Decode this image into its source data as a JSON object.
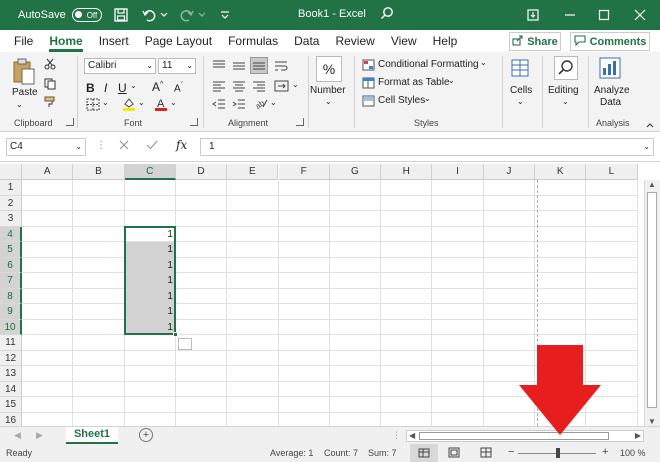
{
  "titlebar": {
    "autosave_label": "AutoSave",
    "autosave_state": "Off",
    "title": "Book1  -  Excel"
  },
  "menu": {
    "tabs": [
      "File",
      "Home",
      "Insert",
      "Page Layout",
      "Formulas",
      "Data",
      "Review",
      "View",
      "Help"
    ],
    "active": "Home",
    "share_label": "Share",
    "comments_label": "Comments"
  },
  "ribbon": {
    "clipboard": {
      "paste_label": "Paste",
      "group_label": "Clipboard"
    },
    "font": {
      "font_name": "Calibri",
      "font_size": "11",
      "group_label": "Font"
    },
    "alignment": {
      "group_label": "Alignment"
    },
    "number": {
      "format_label": "Number",
      "percent_symbol": "%"
    },
    "styles": {
      "conditional_formatting": "Conditional Formatting",
      "format_as_table": "Format as Table",
      "cell_styles": "Cell Styles",
      "group_label": "Styles"
    },
    "cells": {
      "label": "Cells"
    },
    "editing": {
      "label": "Editing"
    },
    "analysis": {
      "analyze_data_line1": "Analyze",
      "analyze_data_line2": "Data",
      "group_label": "Analysis"
    }
  },
  "formula_bar": {
    "name_box": "C4",
    "formula": "1",
    "fx_label": "fx"
  },
  "grid": {
    "columns": [
      "A",
      "B",
      "C",
      "D",
      "E",
      "F",
      "G",
      "H",
      "I",
      "J",
      "K",
      "L"
    ],
    "selected_column": "C",
    "rows": [
      "1",
      "2",
      "3",
      "4",
      "5",
      "6",
      "7",
      "8",
      "9",
      "10",
      "11",
      "12",
      "13",
      "14",
      "15",
      "16"
    ],
    "selected_rows": [
      "4",
      "5",
      "6",
      "7",
      "8",
      "9",
      "10"
    ],
    "c_values": [
      "1",
      "1",
      "1",
      "1",
      "1",
      "1",
      "1"
    ]
  },
  "sheets": {
    "tabs": [
      "Sheet1"
    ],
    "add_symbol": "+"
  },
  "status": {
    "ready": "Ready",
    "average": "Average: 1",
    "count": "Count: 7",
    "sum": "Sum: 7",
    "zoom": "100 %",
    "zoom_minus": "−",
    "zoom_plus": "+"
  },
  "colors": {
    "brand_green": "#217346",
    "arrow_red": "#e81e1e"
  }
}
